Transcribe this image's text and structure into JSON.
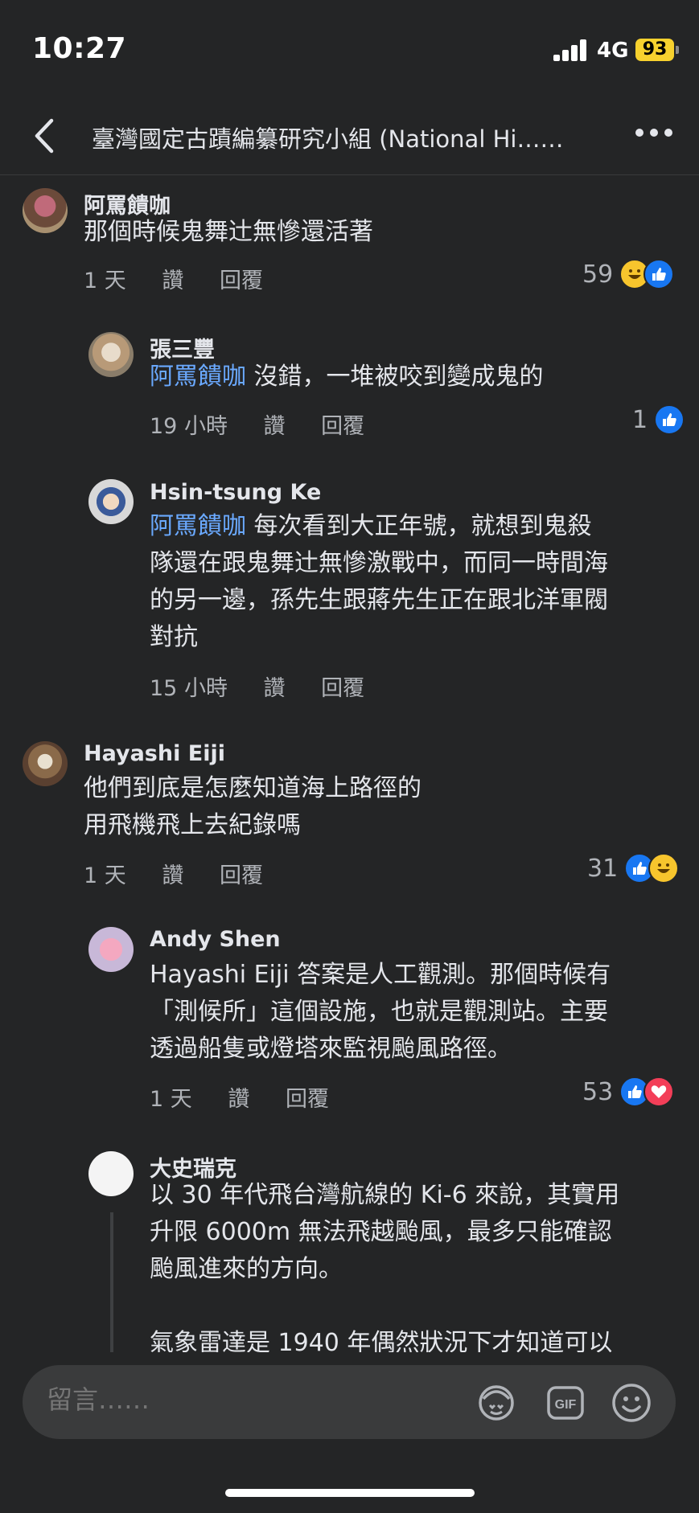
{
  "status_bar": {
    "time": "10:27",
    "network": "4G",
    "battery": "93"
  },
  "header": {
    "title": "臺灣國定古蹟編纂研究小組 (National Hi……"
  },
  "comments": [
    {
      "author": "阿罵饋咖",
      "text": "那個時候鬼舞辻無慘還活著",
      "time": "1 天",
      "like_label": "讚",
      "reply_label": "回覆",
      "reaction_count": "59"
    },
    {
      "author": "張三豐",
      "mention": "阿罵饋咖",
      "text": " 沒錯，一堆被咬到變成鬼的",
      "time": "19 小時",
      "like_label": "讚",
      "reply_label": "回覆",
      "reaction_count": "1"
    },
    {
      "author": "Hsin-tsung Ke",
      "mention": "阿罵饋咖",
      "text_line1": " 每次看到大正年號，就想到鬼殺",
      "text_line2": "隊還在跟鬼舞辻無慘激戰中，而同一時間海",
      "text_line3": "的另一邊，孫先生跟蔣先生正在跟北洋軍閥",
      "text_line4": "對抗",
      "time": "15 小時",
      "like_label": "讚",
      "reply_label": "回覆"
    },
    {
      "author": "Hayashi Eiji",
      "text_line1": "他們到底是怎麼知道海上路徑的",
      "text_line2": "用飛機飛上去紀錄嗎",
      "time": "1 天",
      "like_label": "讚",
      "reply_label": "回覆",
      "reaction_count": "31"
    },
    {
      "author": "Andy Shen",
      "text_line1": "Hayashi Eiji 答案是人工觀測。那個時候有",
      "text_line2": "「測候所」這個設施，也就是觀測站。主要",
      "text_line3": "透過船隻或燈塔來監視颱風路徑。",
      "time": "1 天",
      "like_label": "讚",
      "reply_label": "回覆",
      "reaction_count": "53"
    },
    {
      "author": "大史瑞克",
      "text_line1": "以 30 年代飛台灣航線的 Ki-6 來說，其實用",
      "text_line2": "升限 6000m 無法飛越颱風，最多只能確認",
      "text_line3": "颱風進來的方向。",
      "text_line4": "氣象雷達是 1940 年偶然狀況下才知道可以"
    }
  ],
  "composer": {
    "placeholder": "留言……",
    "gif_label": "GIF"
  },
  "icons": {
    "back": "chevron-left-icon",
    "more": "more-horizontal-icon",
    "like": "like-icon",
    "haha": "haha-icon",
    "love": "love-icon",
    "avatar_sticker": "avatar-sticker-icon",
    "gif": "gif-icon",
    "emoji": "emoji-icon"
  },
  "colors": {
    "background": "#242526",
    "mention": "#6aa9ff",
    "like": "#1877f2",
    "love": "#f33e58",
    "haha": "#f7c52d",
    "battery": "#f7d12e"
  }
}
